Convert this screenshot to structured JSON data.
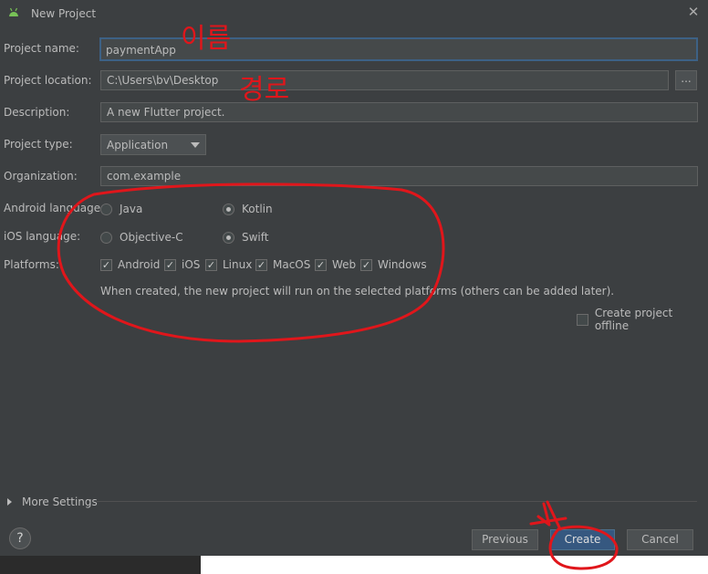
{
  "window": {
    "title": "New Project"
  },
  "form": {
    "project_name": {
      "label": "Project name:",
      "value": "paymentApp"
    },
    "project_location": {
      "label": "Project location:",
      "value": "C:\\Users\\bv\\Desktop",
      "browse_label": "..."
    },
    "description": {
      "label": "Description:",
      "value": "A new Flutter project."
    },
    "project_type": {
      "label": "Project type:",
      "value": "Application"
    },
    "organization": {
      "label": "Organization:",
      "value": "com.example"
    },
    "android_language": {
      "label": "Android language:",
      "options": [
        "Java",
        "Kotlin"
      ],
      "selected": "Kotlin"
    },
    "ios_language": {
      "label": "iOS language:",
      "options": [
        "Objective-C",
        "Swift"
      ],
      "selected": "Swift"
    },
    "platforms": {
      "label": "Platforms:",
      "items": [
        {
          "label": "Android",
          "checked": true
        },
        {
          "label": "iOS",
          "checked": true
        },
        {
          "label": "Linux",
          "checked": true
        },
        {
          "label": "MacOS",
          "checked": true
        },
        {
          "label": "Web",
          "checked": true
        },
        {
          "label": "Windows",
          "checked": true
        }
      ]
    },
    "platforms_hint": "When created, the new project will run on the selected platforms (others can be added later).",
    "create_offline": {
      "label": "Create project offline",
      "checked": false
    }
  },
  "more_settings": "More Settings",
  "help_label": "?",
  "buttons": {
    "previous": "Previous",
    "create": "Create",
    "cancel": "Cancel"
  },
  "annotations": {
    "name_note": "이름",
    "location_note": "경로"
  },
  "colors": {
    "background": "#3c3f41",
    "field": "#45494a",
    "accent": "#365880",
    "annotation_red": "#e0161b"
  },
  "icons": {
    "app": "android-icon",
    "close": "close-icon",
    "help": "help-icon",
    "expand": "triangle-right-icon"
  }
}
